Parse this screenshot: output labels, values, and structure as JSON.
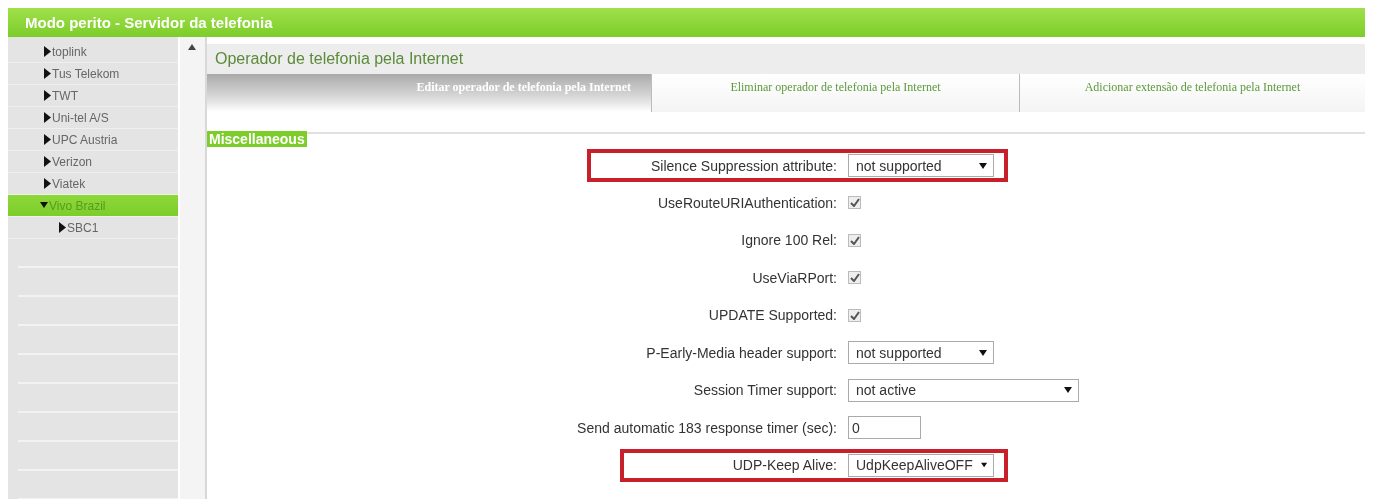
{
  "window": {
    "title": "Modo perito - Servidor da telefonia"
  },
  "sidebar": {
    "items": [
      {
        "label": "toplink",
        "expanded": false,
        "selected": false
      },
      {
        "label": "Tus Telekom",
        "expanded": false,
        "selected": false
      },
      {
        "label": "TWT",
        "expanded": false,
        "selected": false
      },
      {
        "label": "Uni-tel A/S",
        "expanded": false,
        "selected": false
      },
      {
        "label": "UPC Austria",
        "expanded": false,
        "selected": false
      },
      {
        "label": "Verizon",
        "expanded": false,
        "selected": false
      },
      {
        "label": "Viatek",
        "expanded": false,
        "selected": false
      },
      {
        "label": "Vivo Brazil",
        "expanded": true,
        "selected": true,
        "children": [
          {
            "label": "SBC1",
            "expanded": false,
            "selected": false
          }
        ]
      }
    ]
  },
  "content": {
    "heading": "Operador de telefonia pela Internet",
    "tabs": [
      {
        "label": "Editar operador de telefonia pela Internet",
        "selected": true
      },
      {
        "label": "Eliminar operador de telefonia pela Internet",
        "selected": false
      },
      {
        "label": "Adicionar extensão de telefonia pela Internet",
        "selected": false
      }
    ],
    "section": "Miscellaneous",
    "fields": [
      {
        "kind": "select",
        "label": "Silence Suppression attribute:",
        "value": "not supported",
        "highlighted": true
      },
      {
        "kind": "checkbox",
        "label": "UseRouteURIAuthentication:",
        "checked": true,
        "highlighted": false
      },
      {
        "kind": "checkbox",
        "label": "Ignore 100 Rel:",
        "checked": true,
        "highlighted": false
      },
      {
        "kind": "checkbox",
        "label": "UseViaRPort:",
        "checked": true,
        "highlighted": false
      },
      {
        "kind": "checkbox",
        "label": "UPDATE Supported:",
        "checked": true,
        "highlighted": false
      },
      {
        "kind": "select",
        "label": "P-Early-Media header support:",
        "value": "not supported",
        "highlighted": false
      },
      {
        "kind": "wideselect",
        "label": "Session Timer support:",
        "value": "not active",
        "highlighted": false
      },
      {
        "kind": "text",
        "label": "Send automatic 183 response timer (sec):",
        "value": "0",
        "highlighted": false
      },
      {
        "kind": "select",
        "label": "UDP-Keep Alive:",
        "value": "UdpKeepAliveOFF",
        "highlighted": true
      }
    ]
  }
}
